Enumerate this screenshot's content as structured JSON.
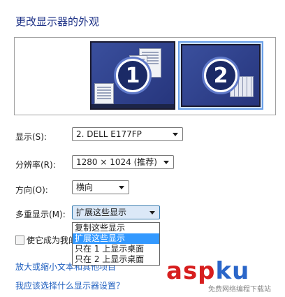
{
  "header": {
    "title": "更改显示器的外观"
  },
  "monitors": [
    {
      "number": "1",
      "selected": false
    },
    {
      "number": "2",
      "selected": true
    }
  ],
  "display": {
    "label": "显示(S):",
    "value": "2. DELL E177FP"
  },
  "resolution": {
    "label": "分辨率(R):",
    "value": "1280 × 1024 (推荐)"
  },
  "orientation": {
    "label": "方向(O):",
    "value": "横向"
  },
  "multi_display": {
    "label": "多重显示(M):",
    "value": "扩展这些显示",
    "options": [
      "复制这些显示",
      "扩展这些显示",
      "只在 1 上显示桌面",
      "只在 2 上显示桌面"
    ],
    "highlighted_index": 1
  },
  "main_display": {
    "label": "使它成为我的主显示器",
    "checked": false
  },
  "links": {
    "text_size": "放大或缩小文本和其他项目",
    "which_settings": "我应该选择什么显示器设置？"
  },
  "watermark": {
    "brand": "asp",
    "brand_suffix": "ku",
    "tagline": "免费网络编程下载站"
  },
  "colors": {
    "title": "#1e3287",
    "link": "#1f5fbf",
    "highlight": "#3399ff"
  }
}
